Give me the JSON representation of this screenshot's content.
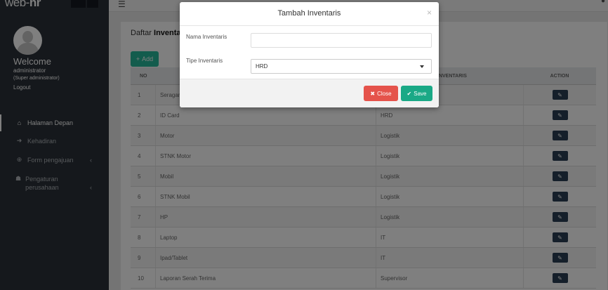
{
  "brand": {
    "name_part1": "web-",
    "name_part2": "hr"
  },
  "sidebar": {
    "welcome": "Welcome",
    "username": "administrator",
    "role": "(Super administrator)",
    "logout": "Logout",
    "items": [
      {
        "label": "Halaman Depan",
        "icon": "home-icon"
      },
      {
        "label": "Kehadiran",
        "icon": "sign-in-icon"
      },
      {
        "label": "Form pengajuan",
        "icon": "plus-circle-icon"
      },
      {
        "label": "Pengaturan perusahaan",
        "icon": "users-icon"
      }
    ]
  },
  "page": {
    "title_prefix": "Daftar ",
    "title_bold": "Inventa",
    "add_label": "Add"
  },
  "table": {
    "headers": {
      "no": "NO",
      "type": "INVENTARIS",
      "action": "ACTION"
    },
    "rows": [
      {
        "no": "1",
        "name": "Seragam",
        "type": ""
      },
      {
        "no": "2",
        "name": "ID Card",
        "type": "HRD"
      },
      {
        "no": "3",
        "name": "Motor",
        "type": "Logistik"
      },
      {
        "no": "4",
        "name": "STNK Motor",
        "type": "Logistik"
      },
      {
        "no": "5",
        "name": "Mobil",
        "type": "Logistik"
      },
      {
        "no": "6",
        "name": "STNK Mobil",
        "type": "Logistik"
      },
      {
        "no": "7",
        "name": "HP",
        "type": "Logistik"
      },
      {
        "no": "8",
        "name": "Laptop",
        "type": "IT"
      },
      {
        "no": "9",
        "name": "Ipad/Tablet",
        "type": "IT"
      },
      {
        "no": "10",
        "name": "Laporan Serah Terima",
        "type": "Supervisor"
      }
    ]
  },
  "modal": {
    "title": "Tambah Inventaris",
    "close_x": "×",
    "name_label": "Nama Inventaris",
    "name_value": "",
    "type_label": "Tipe Inventaris",
    "type_value": "HRD",
    "close_label": "Close",
    "save_label": "Save"
  },
  "colors": {
    "accent": "#26b99a",
    "danger": "#e5534b",
    "sidebar": "#2a3138"
  }
}
